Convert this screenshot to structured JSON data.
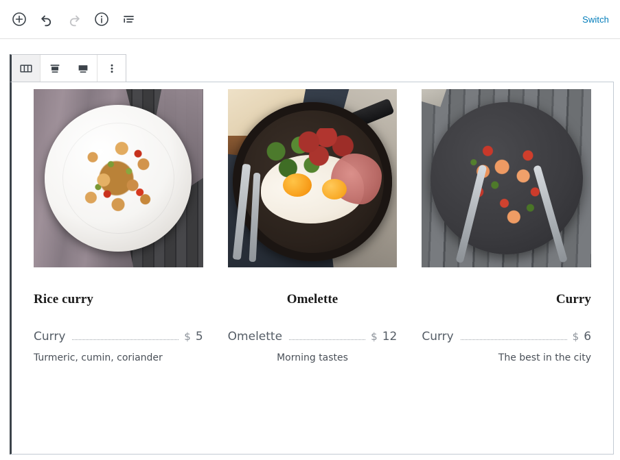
{
  "header": {
    "tools": [
      {
        "name": "add-block-button",
        "icon": "plus-circle-icon",
        "label": "Add block",
        "disabled": false
      },
      {
        "name": "undo-button",
        "icon": "undo-icon",
        "label": "Undo",
        "disabled": false
      },
      {
        "name": "redo-button",
        "icon": "redo-icon",
        "label": "Redo",
        "disabled": true
      },
      {
        "name": "details-button",
        "icon": "info-circle-icon",
        "label": "Details",
        "disabled": false
      },
      {
        "name": "list-view-button",
        "icon": "list-view-icon",
        "label": "List view",
        "disabled": false
      }
    ],
    "switch_label": "Switch",
    "switch_color": "#007cba"
  },
  "block_toolbar": {
    "buttons": [
      {
        "name": "block-type-columns-button",
        "icon": "columns-icon",
        "label": "Columns",
        "active": true
      },
      {
        "name": "align-center-button",
        "icon": "align-center-icon",
        "label": "Align center",
        "active": false
      },
      {
        "name": "align-wide-button",
        "icon": "align-wide-icon",
        "label": "Wide width",
        "active": false
      },
      {
        "name": "more-options-button",
        "icon": "vertical-dots-icon",
        "label": "Options",
        "active": false
      }
    ]
  },
  "columns": [
    {
      "align": "left",
      "image_alt": "Chicken stir fry on a white plate with grey napkin on dark wood",
      "heading": "Rice curry",
      "item_name": "Curry",
      "currency": "$",
      "price": "5",
      "description": "Turmeric, cumin, coriander"
    },
    {
      "align": "center",
      "image_alt": "Skillet breakfast with fried eggs, salami, prosciutto and arugula",
      "heading": "Omelette",
      "item_name": "Omelette",
      "currency": "$",
      "price": "12",
      "description": "Morning tastes"
    },
    {
      "align": "right",
      "image_alt": "Shrimp couscous salad on a dark plate with two forks on weathered wood",
      "heading": "Curry",
      "item_name": "Curry",
      "currency": "$",
      "price": "6",
      "description": "The best in the city"
    }
  ],
  "theme": {
    "selection_border": "#3c434a",
    "block_border": "#c3cad3",
    "toolbar_border": "#c9ccd1",
    "icon_color": "#3c434a",
    "icon_disabled_color": "#c3c4c7",
    "text_muted": "#555d66",
    "text_price_symbol": "#8b9199"
  }
}
